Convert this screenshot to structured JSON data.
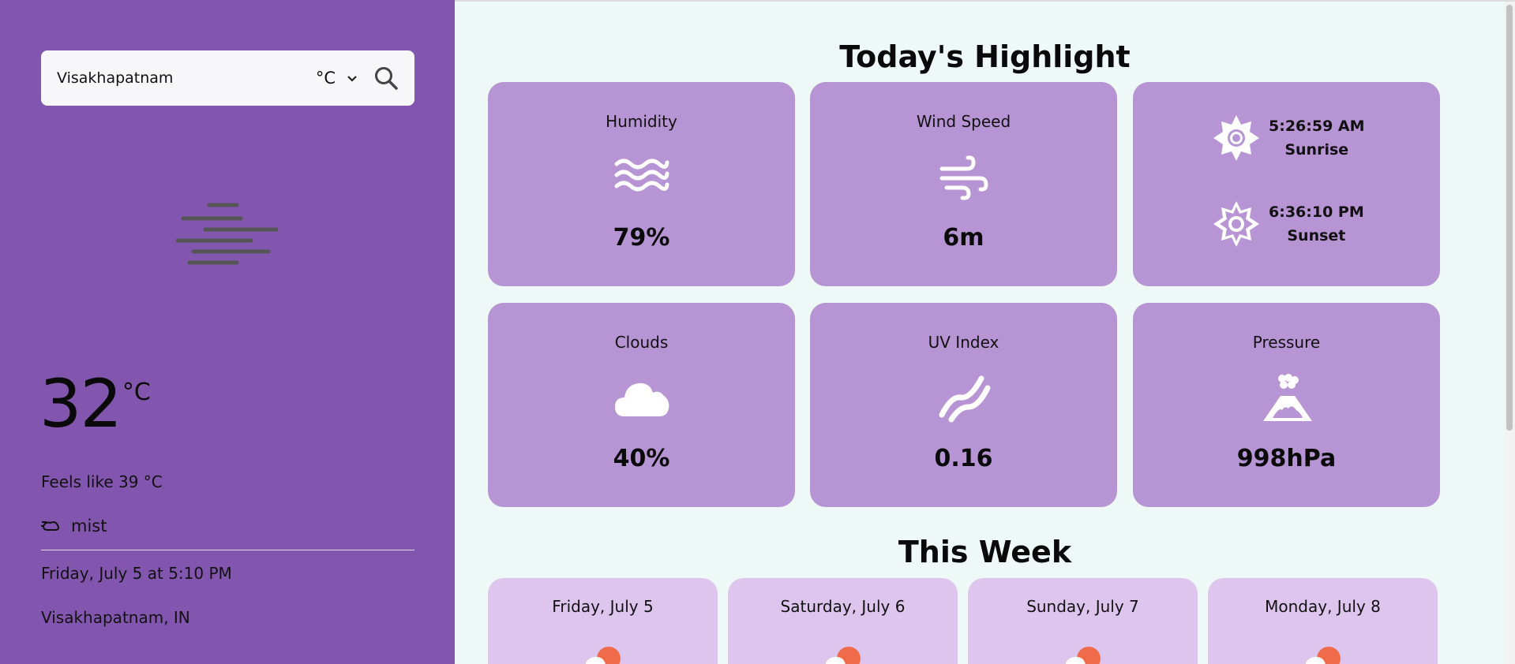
{
  "search": {
    "value": "Visakhapatnam",
    "unit": "°C"
  },
  "current": {
    "temp": "32",
    "unit": "°C",
    "feels_like": "Feels like 39 °C",
    "condition": "mist",
    "datetime": "Friday, July 5 at 5:10 PM",
    "location": "Visakhapatnam, IN",
    "icon": "mist-icon"
  },
  "highlights": {
    "title": "Today's Highlight",
    "humidity": {
      "label": "Humidity",
      "value": "79%",
      "icon": "waves-icon"
    },
    "wind": {
      "label": "Wind Speed",
      "value": "6m",
      "icon": "wind-icon"
    },
    "sunrise": {
      "time": "5:26:59 AM",
      "label": "Sunrise",
      "icon": "sun-icon"
    },
    "sunset": {
      "time": "6:36:10 PM",
      "label": "Sunset",
      "icon": "sun-outline-icon"
    },
    "clouds": {
      "label": "Clouds",
      "value": "40%",
      "icon": "cloud-icon"
    },
    "uv": {
      "label": "UV Index",
      "value": "0.16",
      "icon": "uv-icon"
    },
    "pressure": {
      "label": "Pressure",
      "value": "998hPa",
      "icon": "volcano-icon"
    }
  },
  "week": {
    "title": "This Week",
    "days": [
      {
        "label": "Friday, July 5"
      },
      {
        "label": "Saturday, July 6"
      },
      {
        "label": "Sunday, July 7"
      },
      {
        "label": "Monday, July 8"
      }
    ]
  },
  "colors": {
    "sidebar": "#8256ae",
    "card": "#b794d4",
    "day_card": "#ddc5ee",
    "background": "#eef8f6"
  }
}
